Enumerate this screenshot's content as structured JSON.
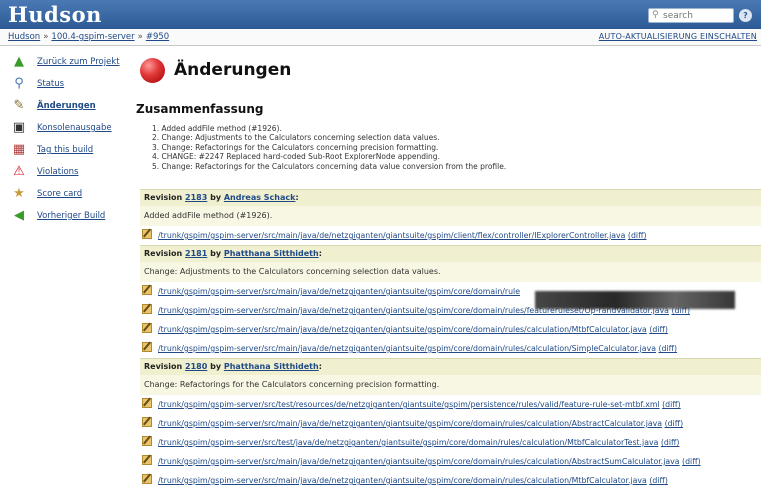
{
  "header": {
    "logo": "Hudson",
    "search_placeholder": "search",
    "help": "?"
  },
  "breadcrumb": {
    "items": [
      "Hudson",
      "100.4-gspim-server",
      "#950"
    ],
    "separator": "»",
    "auto_refresh": "AUTO-AKTUALISIERUNG EINSCHALTEN"
  },
  "sidebar": {
    "items": [
      {
        "label": "Zurück zum Projekt",
        "icon": "up-arrow-icon"
      },
      {
        "label": "Status",
        "icon": "magnifier-icon"
      },
      {
        "label": "Änderungen",
        "icon": "notepad-icon"
      },
      {
        "label": "Konsolenausgabe",
        "icon": "terminal-icon"
      },
      {
        "label": "Tag this build",
        "icon": "tag-icon"
      },
      {
        "label": "Violations",
        "icon": "warning-icon"
      },
      {
        "label": "Score card",
        "icon": "scorecard-icon"
      },
      {
        "label": "Vorheriger Build",
        "icon": "left-arrow-icon"
      }
    ]
  },
  "main": {
    "title": "Änderungen",
    "summary_heading": "Zusammenfassung",
    "summary": [
      "1.  Added addFile method (#1926).",
      "2.  Change: Adjustments to the Calculators concerning selection data values.",
      "3.  Change: Refactorings for the Calculators concerning precision formatting.",
      "4.  CHANGE: #2247 Replaced hard-coded Sub-Root ExplorerNode appending.",
      "5.  Change: Refactorings for the Calculators concerning data value conversion from the profile."
    ]
  },
  "revisions": [
    {
      "prefix": "Revision",
      "number": "2183",
      "by": "by",
      "author": "Andreas Schack",
      "colon": ":",
      "message": "Added addFile method (#1926).",
      "files": [
        "/trunk/gspim/gspim-server/src/main/java/de/netzgiganten/giantsuite/gspim/client/flex/controller/IExplorerController.java"
      ]
    },
    {
      "prefix": "Revision",
      "number": "2181",
      "by": "by",
      "author": "Phatthana Sitthideth",
      "colon": ":",
      "message": "Change: Adjustments to the Calculators concerning selection data values.",
      "files": [
        "/trunk/gspim/gspim-server/src/main/java/de/netzgiganten/giantsuite/gspim/core/domain/rule",
        "/trunk/gspim/gspim-server/src/main/java/de/netzgiganten/giantsuite/gspim/core/domain/rules/featureruleset/Op-randValidator.java",
        "/trunk/gspim/gspim-server/src/main/java/de/netzgiganten/giantsuite/gspim/core/domain/rules/calculation/MtbfCalculator.java",
        "/trunk/gspim/gspim-server/src/main/java/de/netzgiganten/giantsuite/gspim/core/domain/rules/calculation/SimpleCalculator.java"
      ]
    },
    {
      "prefix": "Revision",
      "number": "2180",
      "by": "by",
      "author": "Phatthana Sitthideth",
      "colon": ":",
      "message": "Change: Refactorings for the Calculators concerning precision formatting.",
      "files": [
        "/trunk/gspim/gspim-server/src/test/resources/de/netzgiganten/giantsuite/gspim/persistence/rules/valid/feature-rule-set-mtbf.xml",
        "/trunk/gspim/gspim-server/src/main/java/de/netzgiganten/giantsuite/gspim/core/domain/rules/calculation/AbstractCalculator.java",
        "/trunk/gspim/gspim-server/src/test/java/de/netzgiganten/giantsuite/gspim/core/domain/rules/calculation/MtbfCalculatorTest.java",
        "/trunk/gspim/gspim-server/src/main/java/de/netzgiganten/giantsuite/gspim/core/domain/rules/calculation/AbstractSumCalculator.java",
        "/trunk/gspim/gspim-server/src/main/java/de/netzgiganten/giantsuite/gspim/core/domain/rules/calculation/MtbfCalculator.java"
      ]
    }
  ],
  "diff_label": "(diff)",
  "colors": {
    "header": "#2d5a94",
    "link": "#204a87",
    "rev_header_bg": "#f0f0d0",
    "status_red": "#e23a3a"
  }
}
